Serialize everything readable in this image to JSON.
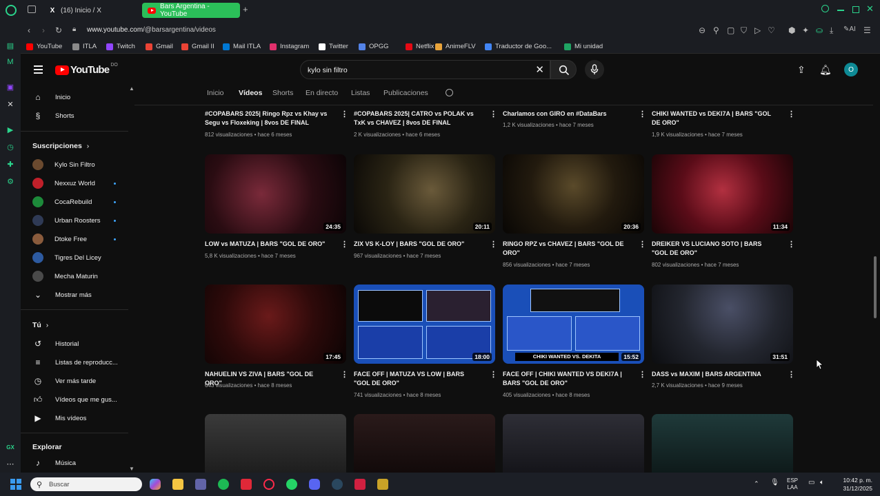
{
  "browser": {
    "tabs": [
      {
        "label": "(16) Inicio / X",
        "icon": "x-icon"
      },
      {
        "label": "Bars Argentina - YouTube",
        "icon": "youtube-icon"
      }
    ],
    "url_prefix": "www.youtube.com",
    "url_path": "/@barsargentina/videos",
    "bookmarks": [
      {
        "label": "YouTube",
        "color": "#ff0000"
      },
      {
        "label": "ITLA",
        "color": "#aaaaaa"
      },
      {
        "label": "Twitch",
        "color": "#9146ff"
      },
      {
        "label": "Gmail",
        "color": "#ea4335"
      },
      {
        "label": "Gmail II",
        "color": "#ea4335"
      },
      {
        "label": "Mail ITLA",
        "color": "#0078d4"
      },
      {
        "label": "Instagram",
        "color": "#e1306c"
      },
      {
        "label": "Twitter",
        "color": "#ffffff"
      },
      {
        "label": "OPGG",
        "color": "#5383e8"
      },
      {
        "label": "Netflix",
        "color": "#e50914"
      },
      {
        "label": "AnimeFLV",
        "color": "#e8a33a"
      },
      {
        "label": "Traductor de Goo...",
        "color": "#4285f4"
      },
      {
        "label": "Mi unidad",
        "color": "#1fa463"
      }
    ]
  },
  "youtube": {
    "logo_text": "YouTube",
    "country_code": "DO",
    "search_query": "kylo sin filtro",
    "avatar_letter": "O"
  },
  "nav": {
    "main": [
      {
        "label": "Inicio",
        "icon": "home-icon"
      },
      {
        "label": "Shorts",
        "icon": "shorts-icon"
      }
    ],
    "subs_heading": "Suscripciones",
    "subs": [
      {
        "label": "Kylo Sin Filtro",
        "color": "#6b4a2f",
        "dot": false
      },
      {
        "label": "Nexxuz World",
        "color": "#c0202a",
        "dot": true
      },
      {
        "label": "CocaRebuild",
        "color": "#1d8a3a",
        "dot": true
      },
      {
        "label": "Urban Roosters",
        "color": "#2f3a55",
        "dot": true
      },
      {
        "label": "Dtoke Free",
        "color": "#8a5b3c",
        "dot": true
      },
      {
        "label": "Tigres Del Licey",
        "color": "#2d5aa0",
        "dot": false
      },
      {
        "label": "Mecha Maturin",
        "color": "#4a4a4a",
        "dot": false
      }
    ],
    "show_more": "Mostrar más",
    "you_heading": "Tú",
    "you": [
      {
        "label": "Historial",
        "icon": "history-icon"
      },
      {
        "label": "Listas de reproducc...",
        "icon": "playlist-icon"
      },
      {
        "label": "Ver más tarde",
        "icon": "clock-icon"
      },
      {
        "label": "Vídeos que me gus...",
        "icon": "thumbs-up-icon"
      },
      {
        "label": "Mis vídeos",
        "icon": "my-videos-icon"
      }
    ],
    "explore_heading": "Explorar",
    "explore": [
      {
        "label": "Música",
        "icon": "music-icon"
      }
    ]
  },
  "channel_tabs": [
    "Inicio",
    "Vídeos",
    "Shorts",
    "En directo",
    "Listas",
    "Publicaciones"
  ],
  "videos": [
    {
      "title": "#COPABARS 2025| Ringo Rpz vs Khay vs Segu vs Floxeking | 8vos DE FINAL",
      "views": "812 visualizaciones",
      "age": "hace 6 meses",
      "duration": ""
    },
    {
      "title": "#COPABARS 2025| CATRO vs POLAK vs TxK vs CHAVEZ | 8vos DE FINAL",
      "views": "2 K visualizaciones",
      "age": "hace 6 meses",
      "duration": ""
    },
    {
      "title": "Charlamos con GIRO en #DataBars",
      "views": "1,2 K visualizaciones",
      "age": "hace 7 meses",
      "duration": ""
    },
    {
      "title": "CHIKI WANTED vs DEKI7A | BARS \"GOL DE ORO\"",
      "views": "1,9 K visualizaciones",
      "age": "hace 7 meses",
      "duration": ""
    },
    {
      "title": "LOW vs MATUZA | BARS \"GOL DE ORO\"",
      "views": "5,8 K visualizaciones",
      "age": "hace 7 meses",
      "duration": "24:35"
    },
    {
      "title": "ZIX VS K-LOY | BARS \"GOL DE ORO\"",
      "views": "967 visualizaciones",
      "age": "hace 7 meses",
      "duration": "20:11"
    },
    {
      "title": "RINGO RPZ vs CHAVEZ | BARS \"GOL DE ORO\"",
      "views": "856 visualizaciones",
      "age": "hace 7 meses",
      "duration": "20:36"
    },
    {
      "title": "DREIKER VS LUCIANO SOTO | BARS \"GOL DE ORO\"",
      "views": "802 visualizaciones",
      "age": "hace 7 meses",
      "duration": "11:34"
    },
    {
      "title": "NAHUELIN VS ZIVA | BARS \"GOL DE ORO\"",
      "views": "643 visualizaciones",
      "age": "hace 8 meses",
      "duration": "17:45"
    },
    {
      "title": "FACE OFF | MATUZA VS LOW | BARS \"GOL DE ORO\"",
      "views": "741 visualizaciones",
      "age": "hace 8 meses",
      "duration": "18:00"
    },
    {
      "title": "FACE OFF | CHIKI WANTED VS DEKI7A | BARS \"GOL DE ORO\"",
      "views": "405 visualizaciones",
      "age": "hace 8 meses",
      "duration": "15:52"
    },
    {
      "title": "DASS vs MAXIM | BARS ARGENTINA",
      "views": "2,7 K visualizaciones",
      "age": "hace 9 meses",
      "duration": "31:51"
    }
  ],
  "thumb_overlay_text": "CHIKI WANTED VS. DEKITA",
  "taskbar": {
    "search_placeholder": "Buscar",
    "lang_line1": "ESP",
    "lang_line2": "LAA",
    "time": "10:42 p. m.",
    "date": "31/12/2025"
  },
  "opera_sidebar_label": "GX"
}
